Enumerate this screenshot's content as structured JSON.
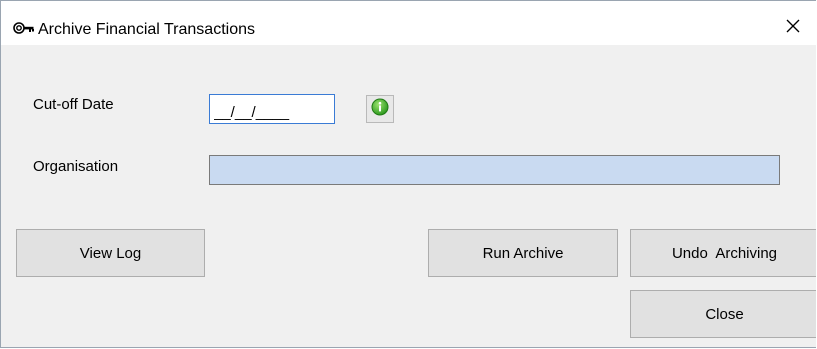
{
  "window": {
    "title": "Archive Financial Transactions",
    "icon": "key-icon",
    "close_glyph": "✕"
  },
  "form": {
    "cutoff_label": "Cut-off Date",
    "cutoff_value": "__/__/____",
    "organisation_label": "Organisation",
    "organisation_value": ""
  },
  "buttons": {
    "view_log": "View Log",
    "run_archive": "Run Archive",
    "undo_archiving": "Undo  Archiving",
    "close": "Close"
  },
  "colors": {
    "dialog_bg": "#f0f0f0",
    "titlebar_bg": "#ffffff",
    "input_focus_border": "#3a7bd5",
    "organisation_bg": "#c9daf1",
    "info_icon_green": "#3fae2a"
  }
}
